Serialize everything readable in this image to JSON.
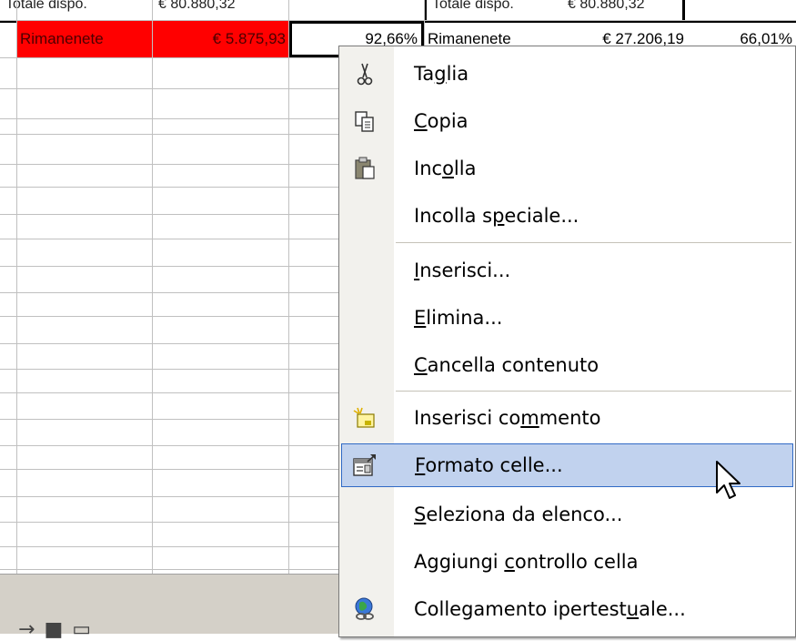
{
  "sheet": {
    "top_row": {
      "left_label": "Totale dispo.",
      "left_value": "€ 80.880,32",
      "right_label": "Totale dispo.",
      "right_value": "€ 80.880,32"
    },
    "row": {
      "label_left": "Rimanenete",
      "value_left": "€ 5.875,93",
      "pct_left": "92,66%",
      "label_right": "Rimanenete",
      "value_right": "€ 27.206,19",
      "pct_right": "66,01%"
    },
    "colors": {
      "highlight": "#ff0000",
      "grid": "#c0c0c0"
    }
  },
  "menu": {
    "items": [
      {
        "pre": "Ta",
        "u": "g",
        "post": "lia",
        "icon": "scissors-icon"
      },
      {
        "pre": "",
        "u": "C",
        "post": "opia",
        "icon": "copy-icon"
      },
      {
        "pre": "Inc",
        "u": "o",
        "post": "lla",
        "icon": "paste-icon"
      },
      {
        "pre": "Incolla s",
        "u": "p",
        "post": "eciale...",
        "icon": ""
      },
      {
        "pre": "",
        "u": "I",
        "post": "nserisci...",
        "icon": ""
      },
      {
        "pre": "",
        "u": "E",
        "post": "limina...",
        "icon": ""
      },
      {
        "pre": "",
        "u": "C",
        "post": "ancella contenuto",
        "icon": ""
      },
      {
        "pre": "Inserisci co",
        "u": "m",
        "post": "mento",
        "icon": "comment-icon"
      },
      {
        "pre": "",
        "u": "F",
        "post": "ormato celle...",
        "icon": "format-cells-icon"
      },
      {
        "pre": "",
        "u": "S",
        "post": "eleziona da elenco...",
        "icon": ""
      },
      {
        "pre": "Aggiungi ",
        "u": "c",
        "post": "ontrollo cella",
        "icon": ""
      },
      {
        "pre": "Collegamento ipertest",
        "u": "u",
        "post": "ale...",
        "icon": "hyperlink-icon"
      }
    ],
    "highlight_color": "#c1d2ee",
    "hovered_index": 8
  }
}
